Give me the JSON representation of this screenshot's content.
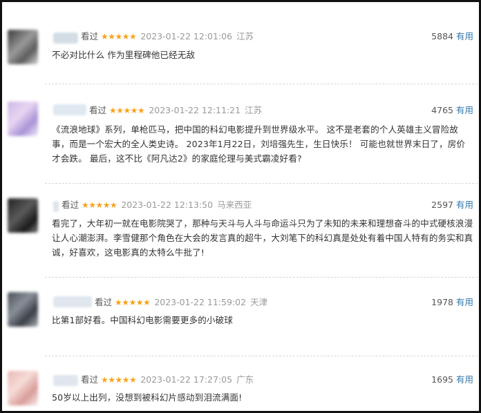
{
  "labels": {
    "watched": "看过",
    "useful": "有用"
  },
  "colors": {
    "star": "#f7a31c",
    "useful_link": "#3377aa",
    "meta_gray": "#999999",
    "text": "#333333"
  },
  "comments": [
    {
      "stars": "★★★★★",
      "time": "2023-01-22 12:01:06",
      "location": "江苏",
      "votes": "5884",
      "content": "不必对比什么 作为里程碑他已经无敌"
    },
    {
      "stars": "★★★★★",
      "time": "2023-01-22 12:11:21",
      "location": "江苏",
      "votes": "4765",
      "content": "《流浪地球》系列，单枪匹马，把中国的科幻电影提升到世界级水平。 这不是老套的个人英雄主义冒险故事，而是一个宏大的全人类史诗。 2023年1月22日，刘培强先生，生日快乐！ 可能也就世界末日了，房价才会跌。 最后，这不比《阿凡达2》的家庭伦理与美式霸凌好看?"
    },
    {
      "stars": "★★★★★",
      "time": "2023-01-22 12:13:50",
      "location": "马来西亚",
      "votes": "2597",
      "content": "看完了，大年初一就在电影院哭了，那种与天斗与人斗与命运斗只为了未知的未来和理想奋斗的中式硬核浪漫让人心潮澎湃。李雪健那个角色在大会的发言真的超牛，大刘笔下的科幻真是处处有着中国人特有的务实和真诚，好喜欢，这电影真的太特么牛批了!"
    },
    {
      "stars": "★★★★★",
      "time": "2023-01-22 11:59:02",
      "location": "天津",
      "votes": "1978",
      "content": "比第1部好看。中国科幻电影需要更多的小破球"
    },
    {
      "stars": "★★★★★",
      "time": "2023-01-22 17:27:05",
      "location": "广东",
      "votes": "1695",
      "content": "50岁以上出列，没想到被科幻片感动到泪流满面!"
    }
  ]
}
